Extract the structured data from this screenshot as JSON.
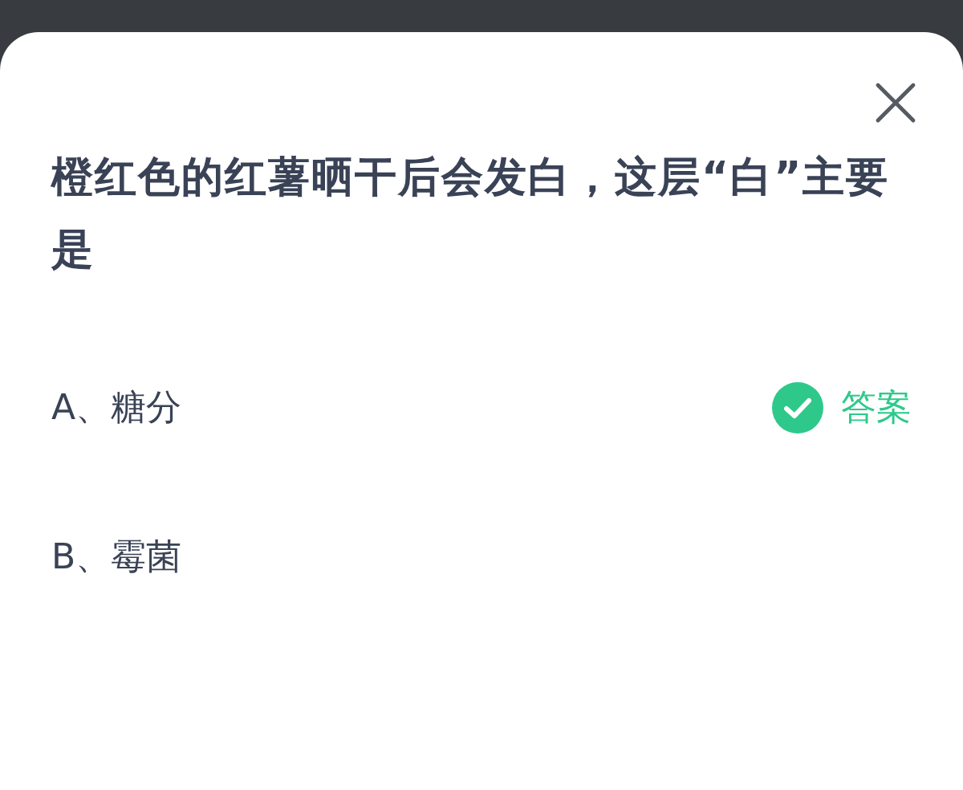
{
  "question": "橙红色的红薯晒干后会发白，这层“白”主要是",
  "options": [
    {
      "text": "A、糖分",
      "correct": true
    },
    {
      "text": "B、霉菌",
      "correct": false
    }
  ],
  "answer_label": "答案"
}
